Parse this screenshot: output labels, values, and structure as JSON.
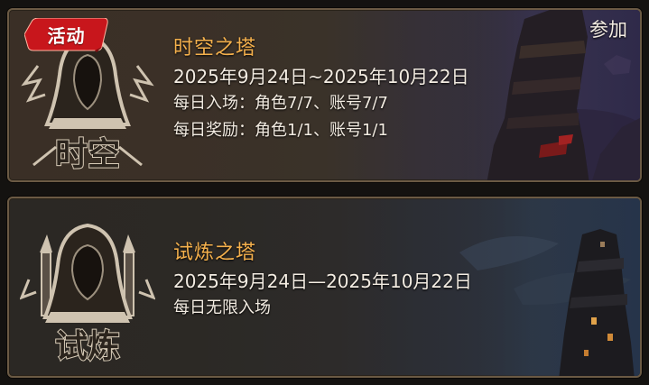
{
  "events": [
    {
      "badge": "活动",
      "action": "参加",
      "emblem_label": "时空",
      "title": "时空之塔",
      "dates": "2025年9月24日~2025年10月22日",
      "entry": "每日入场：角色7/7、账号7/7",
      "reward": "每日奖励：角色1/1、账号1/1"
    },
    {
      "emblem_label": "试炼",
      "title": "试炼之塔",
      "dates": "2025年9月24日—2025年10月22日",
      "entry": "每日无限入场"
    }
  ],
  "colors": {
    "title": "#f4b04c",
    "text": "#f3ece2",
    "badge": "#c8161c",
    "frame": "#6b5a44"
  }
}
